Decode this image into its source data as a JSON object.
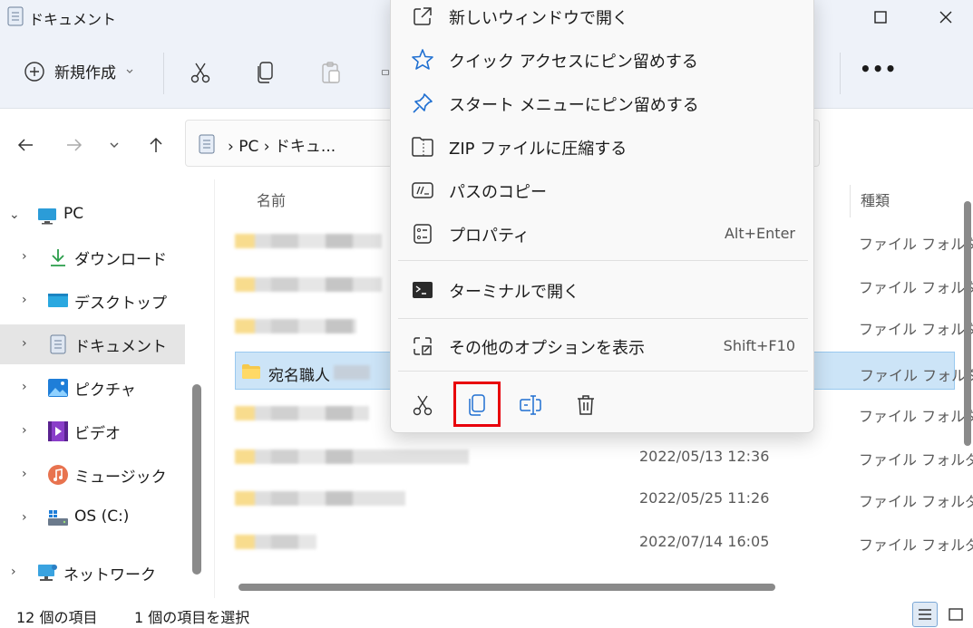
{
  "window": {
    "title": "ドキュメント"
  },
  "toolbar": {
    "new_label": "新規作成",
    "more_label": "•••"
  },
  "address": {
    "path_text": "› PC › ドキュ..."
  },
  "sidebar": {
    "items": [
      {
        "label": "PC",
        "icon": "pc-icon"
      },
      {
        "label": "ダウンロード",
        "icon": "download-icon"
      },
      {
        "label": "デスクトップ",
        "icon": "desktop-icon"
      },
      {
        "label": "ドキュメント",
        "icon": "documents-icon"
      },
      {
        "label": "ピクチャ",
        "icon": "pictures-icon"
      },
      {
        "label": "ビデオ",
        "icon": "videos-icon"
      },
      {
        "label": "ミュージック",
        "icon": "music-icon"
      },
      {
        "label": "OS (C:)",
        "icon": "drive-icon"
      },
      {
        "label": "ネットワーク",
        "icon": "network-icon"
      }
    ]
  },
  "list": {
    "columns": {
      "name": "名前",
      "type": "種類"
    },
    "rows": [
      {
        "name": "",
        "date": "",
        "type": "ファイル フォルダー"
      },
      {
        "name": "",
        "date": "",
        "type": "ファイル フォルダー"
      },
      {
        "name": "",
        "date": "",
        "type": "ファイル フォルダー"
      },
      {
        "name": "宛名職人",
        "date": "",
        "type": "ファイル フォルダー"
      },
      {
        "name": "",
        "date": "",
        "type": "ファイル フォルダー"
      },
      {
        "name": "",
        "date": "2022/05/13 12:36",
        "type": "ファイル フォルダー"
      },
      {
        "name": "",
        "date": "2022/05/25 11:26",
        "type": "ファイル フォルダー"
      },
      {
        "name": "",
        "date": "2022/07/14 16:05",
        "type": "ファイル フォルダー"
      }
    ]
  },
  "status": {
    "count": "12 個の項目",
    "selected": "1 個の項目を選択"
  },
  "menu": {
    "items": [
      {
        "label": "新しいウィンドウで開く",
        "shortcut": "",
        "icon": "open-new-window-icon"
      },
      {
        "label": "クイック アクセスにピン留めする",
        "shortcut": "",
        "icon": "star-icon"
      },
      {
        "label": "スタート メニューにピン留めする",
        "shortcut": "",
        "icon": "pin-icon"
      },
      {
        "label": "ZIP ファイルに圧縮する",
        "shortcut": "",
        "icon": "zip-icon"
      },
      {
        "label": "パスのコピー",
        "shortcut": "",
        "icon": "copy-path-icon"
      },
      {
        "label": "プロパティ",
        "shortcut": "Alt+Enter",
        "icon": "properties-icon"
      },
      {
        "label": "ターミナルで開く",
        "shortcut": "",
        "icon": "terminal-icon"
      },
      {
        "label": "その他のオプションを表示",
        "shortcut": "Shift+F10",
        "icon": "more-options-icon"
      }
    ],
    "bottom_actions": [
      "cut-icon",
      "copy-icon",
      "rename-icon",
      "delete-icon"
    ]
  },
  "colors": {
    "accent": "#005fb8",
    "highlight_box": "#e8000b",
    "selection_bg": "#cce4f7"
  }
}
